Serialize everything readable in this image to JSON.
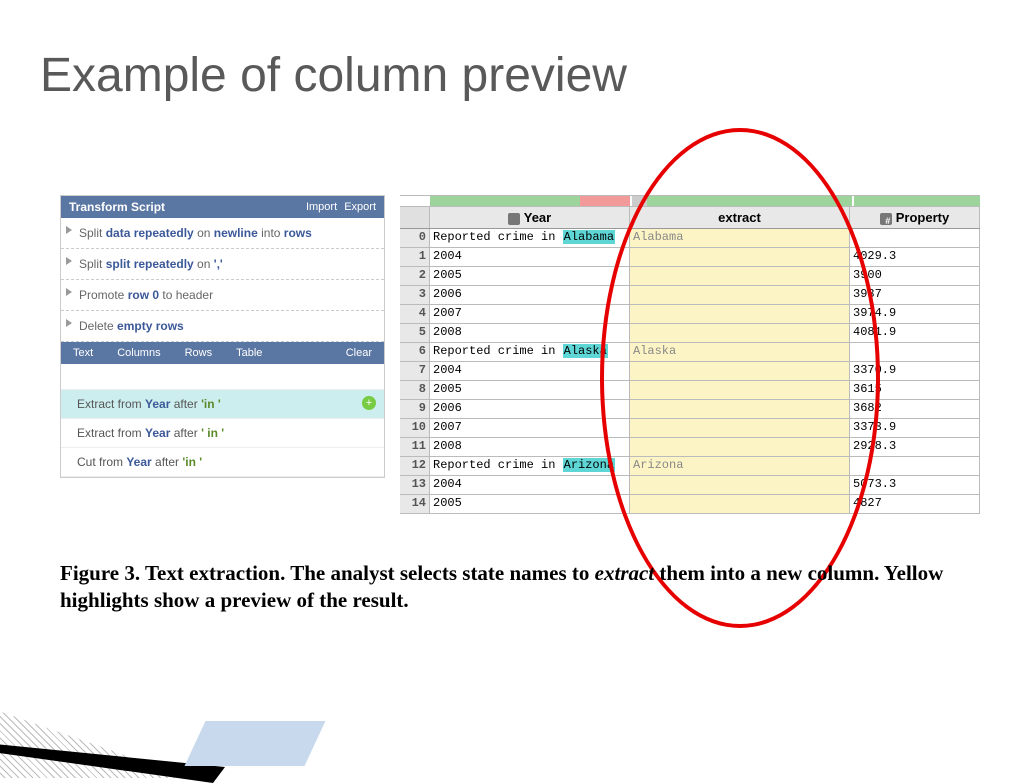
{
  "slide": {
    "title": "Example of column preview"
  },
  "panel": {
    "header": "Transform Script",
    "import": "Import",
    "export": "Export",
    "script_items": [
      {
        "html": "Split <span class='kw'>data repeatedly</span> on <span class='kw'>newline</span> into <span class='kw'>rows</span>"
      },
      {
        "html": "Split <span class='kw'>split repeatedly</span> on <span class='kw'>','</span>"
      },
      {
        "html": "Promote <span class='kw'>row 0</span> to header"
      },
      {
        "html": "Delete <span class='kw'>empty rows</span>"
      }
    ],
    "tabs": {
      "text": "Text",
      "columns": "Columns",
      "rows": "Rows",
      "table": "Table",
      "clear": "Clear"
    },
    "suggestions": [
      {
        "html": "Extract from <span class='kw'>Year</span> after <span class='lit'>'in '</span>",
        "active": true,
        "plus": true
      },
      {
        "html": "Extract from <span class='kw'>Year</span> after <span class='lit'>' in '</span>",
        "active": false
      },
      {
        "html": "Cut from <span class='kw'>Year</span> after <span class='lit'>'in '</span>",
        "active": false
      }
    ]
  },
  "table": {
    "headers": {
      "year": "Year",
      "extract": "extract",
      "property": "Property"
    },
    "rows": [
      {
        "idx": "0",
        "year_pre": "Reported crime in ",
        "year_hl": "Alabama",
        "extract": "Alabama",
        "prop": ""
      },
      {
        "idx": "1",
        "year_pre": "2004",
        "year_hl": "",
        "extract": "",
        "prop": "4029.3"
      },
      {
        "idx": "2",
        "year_pre": "2005",
        "year_hl": "",
        "extract": "",
        "prop": "3900"
      },
      {
        "idx": "3",
        "year_pre": "2006",
        "year_hl": "",
        "extract": "",
        "prop": "3937"
      },
      {
        "idx": "4",
        "year_pre": "2007",
        "year_hl": "",
        "extract": "",
        "prop": "3974.9"
      },
      {
        "idx": "5",
        "year_pre": "2008",
        "year_hl": "",
        "extract": "",
        "prop": "4081.9"
      },
      {
        "idx": "6",
        "year_pre": "Reported crime in ",
        "year_hl": "Alaska",
        "extract": "Alaska",
        "prop": ""
      },
      {
        "idx": "7",
        "year_pre": "2004",
        "year_hl": "",
        "extract": "",
        "prop": "3370.9"
      },
      {
        "idx": "8",
        "year_pre": "2005",
        "year_hl": "",
        "extract": "",
        "prop": "3615"
      },
      {
        "idx": "9",
        "year_pre": "2006",
        "year_hl": "",
        "extract": "",
        "prop": "3682"
      },
      {
        "idx": "10",
        "year_pre": "2007",
        "year_hl": "",
        "extract": "",
        "prop": "3373.9"
      },
      {
        "idx": "11",
        "year_pre": "2008",
        "year_hl": "",
        "extract": "",
        "prop": "2928.3"
      },
      {
        "idx": "12",
        "year_pre": "Reported crime in ",
        "year_hl": "Arizona",
        "extract": "Arizona",
        "prop": ""
      },
      {
        "idx": "13",
        "year_pre": "2004",
        "year_hl": "",
        "extract": "",
        "prop": "5073.3"
      },
      {
        "idx": "14",
        "year_pre": "2005",
        "year_hl": "",
        "extract": "",
        "prop": "4827"
      }
    ]
  },
  "caption": {
    "pre": "Figure 3.  Text extraction.  The analyst selects state names to ",
    "ital": "extract",
    "post": " them into a new column. Yellow highlights show a preview of the result."
  }
}
